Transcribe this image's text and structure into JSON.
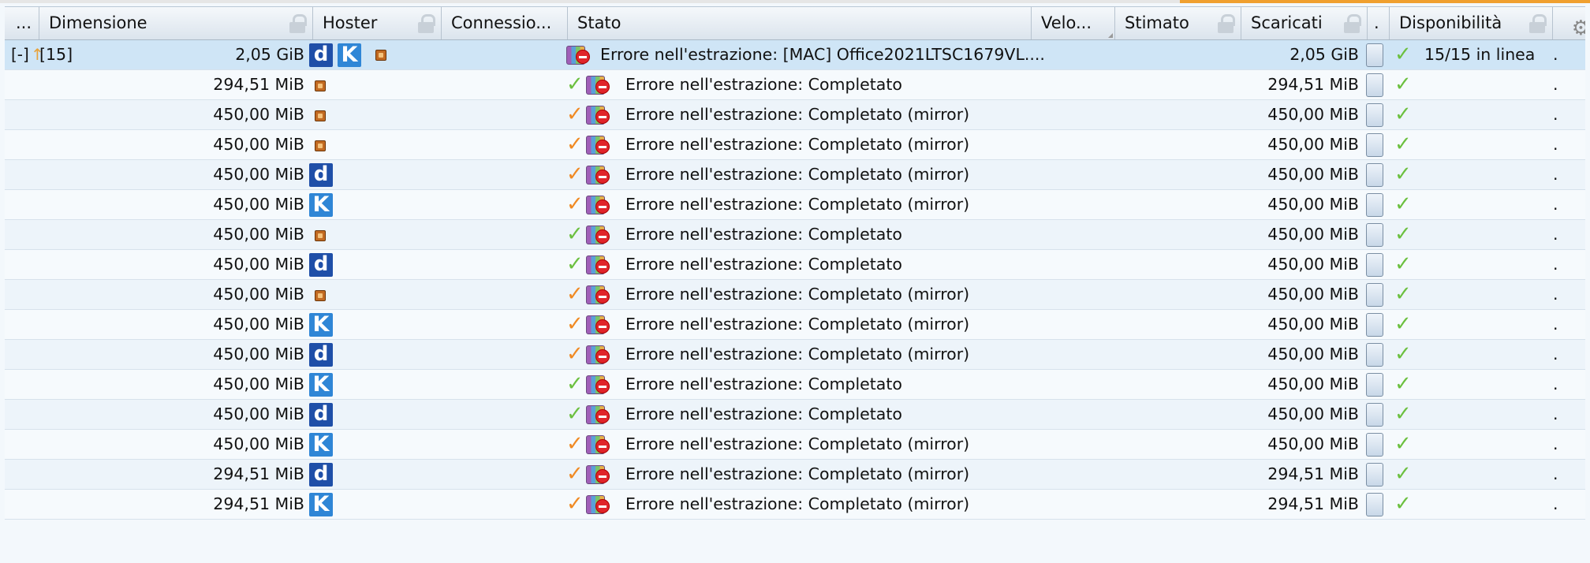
{
  "header": {
    "col_more": "...",
    "col_size": "Dimensione",
    "col_hoster": "Hoster",
    "col_connections": "Connessio...",
    "col_status": "Stato",
    "col_speed": "Velo...",
    "col_eta": "Stimato",
    "col_downloaded": "Scaricati",
    "col_small": ".",
    "col_availability": "Disponibilità"
  },
  "package": {
    "expand": "[-]",
    "count": "[15]",
    "size": "2,05 GiB",
    "status": "Errore nell'estrazione: [MAC] Office2021LTSC1679VL....",
    "downloaded": "2,05 GiB",
    "availability": "15/15 in linea",
    "dot": ".",
    "hosters": [
      "d",
      "K",
      "s"
    ]
  },
  "rows": [
    {
      "size": "294,51 MiB",
      "hoster": "s",
      "check": "green",
      "status": "Errore nell'estrazione: Completato",
      "downloaded": "294,51 MiB",
      "dot": "."
    },
    {
      "size": "450,00 MiB",
      "hoster": "s",
      "check": "orange",
      "status": "Errore nell'estrazione: Completato (mirror)",
      "downloaded": "450,00 MiB",
      "dot": "."
    },
    {
      "size": "450,00 MiB",
      "hoster": "s",
      "check": "orange",
      "status": "Errore nell'estrazione: Completato (mirror)",
      "downloaded": "450,00 MiB",
      "dot": "."
    },
    {
      "size": "450,00 MiB",
      "hoster": "d",
      "check": "orange",
      "status": "Errore nell'estrazione: Completato (mirror)",
      "downloaded": "450,00 MiB",
      "dot": "."
    },
    {
      "size": "450,00 MiB",
      "hoster": "K",
      "check": "orange",
      "status": "Errore nell'estrazione: Completato (mirror)",
      "downloaded": "450,00 MiB",
      "dot": "."
    },
    {
      "size": "450,00 MiB",
      "hoster": "s",
      "check": "green",
      "status": "Errore nell'estrazione: Completato",
      "downloaded": "450,00 MiB",
      "dot": "."
    },
    {
      "size": "450,00 MiB",
      "hoster": "d",
      "check": "green",
      "status": "Errore nell'estrazione: Completato",
      "downloaded": "450,00 MiB",
      "dot": "."
    },
    {
      "size": "450,00 MiB",
      "hoster": "s",
      "check": "orange",
      "status": "Errore nell'estrazione: Completato (mirror)",
      "downloaded": "450,00 MiB",
      "dot": "."
    },
    {
      "size": "450,00 MiB",
      "hoster": "K",
      "check": "orange",
      "status": "Errore nell'estrazione: Completato (mirror)",
      "downloaded": "450,00 MiB",
      "dot": "."
    },
    {
      "size": "450,00 MiB",
      "hoster": "d",
      "check": "orange",
      "status": "Errore nell'estrazione: Completato (mirror)",
      "downloaded": "450,00 MiB",
      "dot": "."
    },
    {
      "size": "450,00 MiB",
      "hoster": "K",
      "check": "green",
      "status": "Errore nell'estrazione: Completato",
      "downloaded": "450,00 MiB",
      "dot": "."
    },
    {
      "size": "450,00 MiB",
      "hoster": "d",
      "check": "green",
      "status": "Errore nell'estrazione: Completato",
      "downloaded": "450,00 MiB",
      "dot": "."
    },
    {
      "size": "450,00 MiB",
      "hoster": "K",
      "check": "orange",
      "status": "Errore nell'estrazione: Completato (mirror)",
      "downloaded": "450,00 MiB",
      "dot": "."
    },
    {
      "size": "294,51 MiB",
      "hoster": "d",
      "check": "orange",
      "status": "Errore nell'estrazione: Completato (mirror)",
      "downloaded": "294,51 MiB",
      "dot": "."
    },
    {
      "size": "294,51 MiB",
      "hoster": "K",
      "check": "orange",
      "status": "Errore nell'estrazione: Completato (mirror)",
      "downloaded": "294,51 MiB",
      "dot": "."
    }
  ],
  "colors": {
    "check_green": "#6cc040",
    "check_orange": "#f08a24",
    "hoster_d": "#1f4fa8",
    "hoster_k": "#2f86d6",
    "package_row": "#cfe5f6"
  },
  "icons": {
    "settings": "gear-icon",
    "locked_column": "lock-icon",
    "extract_error": "no-entry-icon",
    "archive": "archive-icon"
  }
}
